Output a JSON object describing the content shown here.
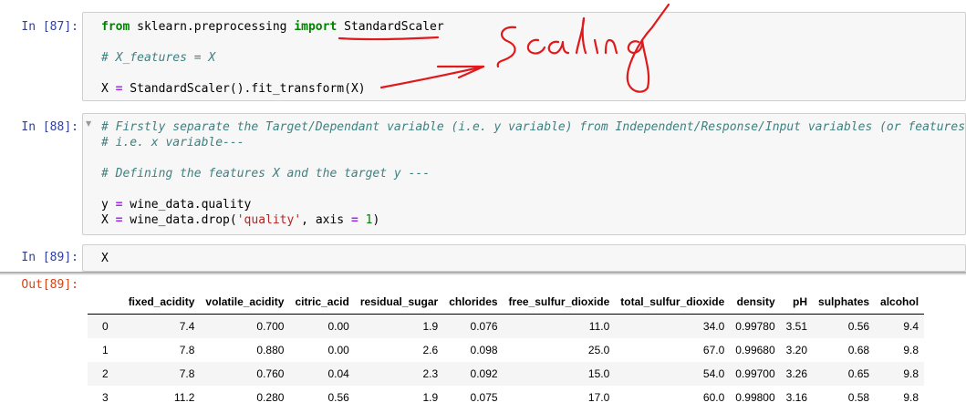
{
  "cells": [
    {
      "prompt": "In [87]:",
      "lines": [
        [
          {
            "t": "from",
            "c": "kw"
          },
          {
            "t": " sklearn.preprocessing ",
            "c": ""
          },
          {
            "t": "import",
            "c": "kw"
          },
          {
            "t": " StandardScaler",
            "c": ""
          }
        ],
        [],
        [
          {
            "t": "# X_features = X",
            "c": "cm"
          }
        ],
        [],
        [
          {
            "t": "X ",
            "c": ""
          },
          {
            "t": "=",
            "c": "op"
          },
          {
            "t": " StandardScaler().fit_transform(X)",
            "c": ""
          }
        ]
      ]
    },
    {
      "prompt": "In [88]:",
      "lines": [
        [
          {
            "t": "# Firstly separate the Target/Dependant variable (i.e. y variable) from Independent/Response/Input variables (or features)",
            "c": "cm"
          }
        ],
        [
          {
            "t": "# i.e. x variable---",
            "c": "cm"
          }
        ],
        [],
        [
          {
            "t": "# Defining the features X and the target y ---",
            "c": "cm"
          }
        ],
        [],
        [
          {
            "t": "y ",
            "c": ""
          },
          {
            "t": "=",
            "c": "op"
          },
          {
            "t": " wine_data.quality",
            "c": ""
          }
        ],
        [
          {
            "t": "X ",
            "c": ""
          },
          {
            "t": "=",
            "c": "op"
          },
          {
            "t": " wine_data.drop(",
            "c": ""
          },
          {
            "t": "'quality'",
            "c": "st"
          },
          {
            "t": ", axis ",
            "c": ""
          },
          {
            "t": "=",
            "c": "op"
          },
          {
            "t": " ",
            "c": ""
          },
          {
            "t": "1",
            "c": "nm"
          },
          {
            "t": ")",
            "c": ""
          }
        ]
      ]
    },
    {
      "prompt": "In [89]:",
      "lines": [
        [
          {
            "t": "X",
            "c": ""
          }
        ]
      ]
    }
  ],
  "output": {
    "prompt": "Out[89]:",
    "columns": [
      "",
      "fixed_acidity",
      "volatile_acidity",
      "citric_acid",
      "residual_sugar",
      "chlorides",
      "free_sulfur_dioxide",
      "total_sulfur_dioxide",
      "density",
      "pH",
      "sulphates",
      "alcohol"
    ],
    "rows": [
      [
        "0",
        "7.4",
        "0.700",
        "0.00",
        "1.9",
        "0.076",
        "11.0",
        "34.0",
        "0.99780",
        "3.51",
        "0.56",
        "9.4"
      ],
      [
        "1",
        "7.8",
        "0.880",
        "0.00",
        "2.6",
        "0.098",
        "25.0",
        "67.0",
        "0.99680",
        "3.20",
        "0.68",
        "9.8"
      ],
      [
        "2",
        "7.8",
        "0.760",
        "0.04",
        "2.3",
        "0.092",
        "15.0",
        "54.0",
        "0.99700",
        "3.26",
        "0.65",
        "9.8"
      ],
      [
        "3",
        "11.2",
        "0.280",
        "0.56",
        "1.9",
        "0.075",
        "17.0",
        "60.0",
        "0.99800",
        "3.16",
        "0.58",
        "9.8"
      ]
    ]
  },
  "annotation": {
    "handwritten_text": "Scaling",
    "ink_color": "#e0191b"
  },
  "colors": {
    "in_prompt": "#303f9f",
    "out_prompt": "#d84315",
    "cell_bg": "#f7f7f7"
  }
}
